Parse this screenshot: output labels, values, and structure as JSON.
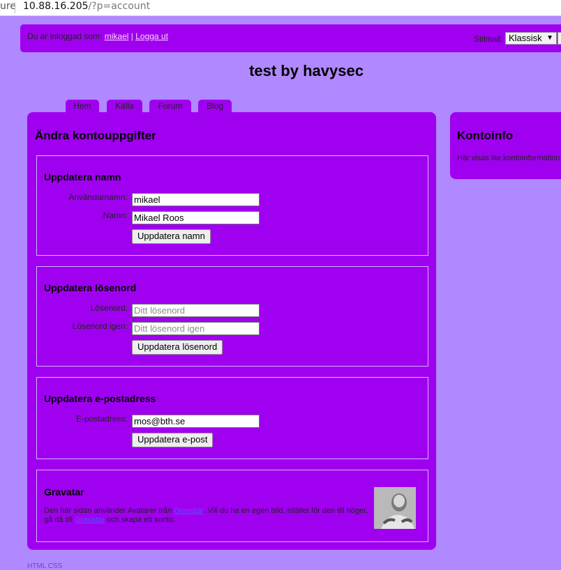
{
  "browser": {
    "secure_fragment": "ure",
    "url_host": "10.88.16.205",
    "url_path": "/?p=account"
  },
  "header": {
    "logged_in_text": "Du är inloggad som:",
    "username": "mikael",
    "separator": "|",
    "logout": "Logga ut",
    "style_label": "Stilmall:",
    "style_value": "Klassisk"
  },
  "site_title": "test by havysec",
  "tabs": [
    "Hem",
    "Källa",
    "Forum",
    "Blog"
  ],
  "main": {
    "heading": "Ändra kontouppgifter",
    "name_section": {
      "title": "Uppdatera namn",
      "username_label": "Användarnamn:",
      "username_value": "mikael",
      "name_label": "Namn:",
      "name_value": "Mikael Roos",
      "button": "Uppdatera namn"
    },
    "password_section": {
      "title": "Uppdatera lösenord",
      "password_label": "Lösenord:",
      "password_placeholder": "Ditt lösenord",
      "password2_label": "Lösenord igen:",
      "password2_placeholder": "Ditt lösenord igen",
      "button": "Uppdatera lösenord"
    },
    "email_section": {
      "title": "Uppdatera e-postadress",
      "email_label": "E-postadress:",
      "email_value": "mos@bth.se",
      "button": "Uppdatera e-post"
    },
    "gravatar_section": {
      "title": "Gravatar",
      "text_1": "Den här sidan använder Avatarer från ",
      "link_1": "Gravatar",
      "text_2": ". Vill du ha en egen bild, istället för den till höger, gå då till ",
      "link_2": "Gravatar",
      "text_3": " och skapa ett konto."
    }
  },
  "side": {
    "heading": "Kontoinfo",
    "text": "Här visas lite kontoinformation."
  },
  "footer": "HTML CSS",
  "colors": {
    "page_background": "#b088ff",
    "panel": "#a000f0",
    "section_border": "#d2b5ff",
    "link_header": "#ffd2ff",
    "link_body": "#5d4dff"
  }
}
